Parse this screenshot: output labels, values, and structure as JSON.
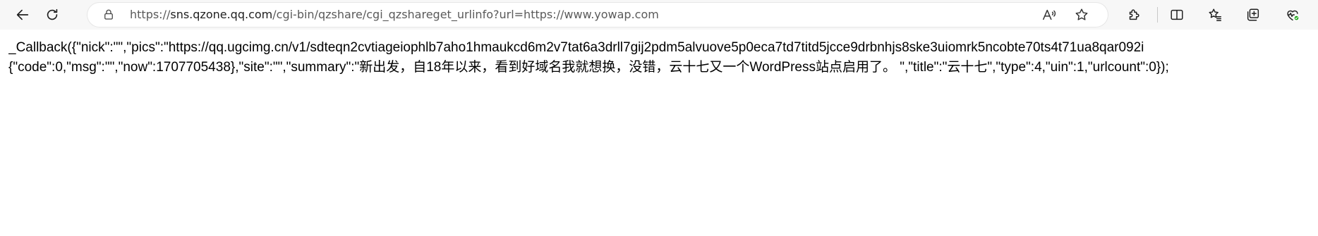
{
  "browser": {
    "url_prefix": "https://",
    "url_host": "sns.qzone.qq.com",
    "url_rest": "/cgi-bin/qzshare/cgi_qzshareget_urlinfo?url=https://www.yowap.com",
    "icons": {
      "back": "back-arrow-icon",
      "refresh": "refresh-icon",
      "lock": "lock-icon",
      "read_aloud": "read-aloud-icon",
      "favorite": "star-icon",
      "extensions": "puzzle-icon",
      "split_screen": "split-screen-icon",
      "favorites": "favorites-list-icon",
      "collections": "collections-icon",
      "health": "browser-essentials-icon"
    },
    "accent_color": "#13a10e"
  },
  "page": {
    "line1": "_Callback({\"nick\":\"\",\"pics\":\"https://qq.ugcimg.cn/v1/sdteqn2cvtiageiophlb7aho1hmaukcd6m2v7tat6a3drll7gij2pdm5alvuove5p0eca7td7titd5jcce9drbnhjs8ske3uiomrk5ncobte70ts4t71ua8qar092i",
    "line2": "{\"code\":0,\"msg\":\"\",\"now\":1707705438},\"site\":\"\",\"summary\":\"新出发，自18年以来，看到好域名我就想换，没错，云十七又一个WordPress站点启用了。 \",\"title\":\"云十七\",\"type\":4,\"uin\":1,\"urlcount\":0});"
  }
}
